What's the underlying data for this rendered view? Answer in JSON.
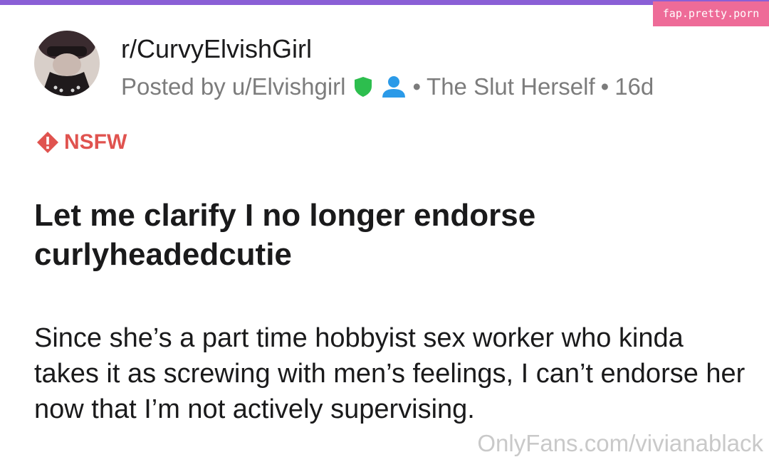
{
  "watermark_tag": "fap.pretty.porn",
  "post": {
    "subreddit": "r/CurvyElvishGirl",
    "posted_by": "Posted by u/Elvishgirl",
    "flair": "The Slut Herself",
    "separator": "•",
    "age": "16d",
    "nsfw_label": "NSFW",
    "title": "Let me clarify I no longer endorse curlyheadedcutie",
    "body": "Since she’s a part time hobbyist sex worker who kinda takes it as screwing with men’s feelings, I can’t endorse her now that I’m not actively supervising."
  },
  "footer_watermark": "OnlyFans.com/vivianablack",
  "icons": {
    "moderator": "shield-icon",
    "user": "user-icon",
    "nsfw": "warning-diamond-icon"
  },
  "colors": {
    "top_bar": "#8a5fd6",
    "tag_bg": "#ee6b98",
    "mod_shield": "#2dbe4e",
    "user_icon": "#2b9ae8",
    "nsfw": "#e0534f",
    "meta_text": "#7c7c7c",
    "watermark": "#c9c9c9"
  }
}
